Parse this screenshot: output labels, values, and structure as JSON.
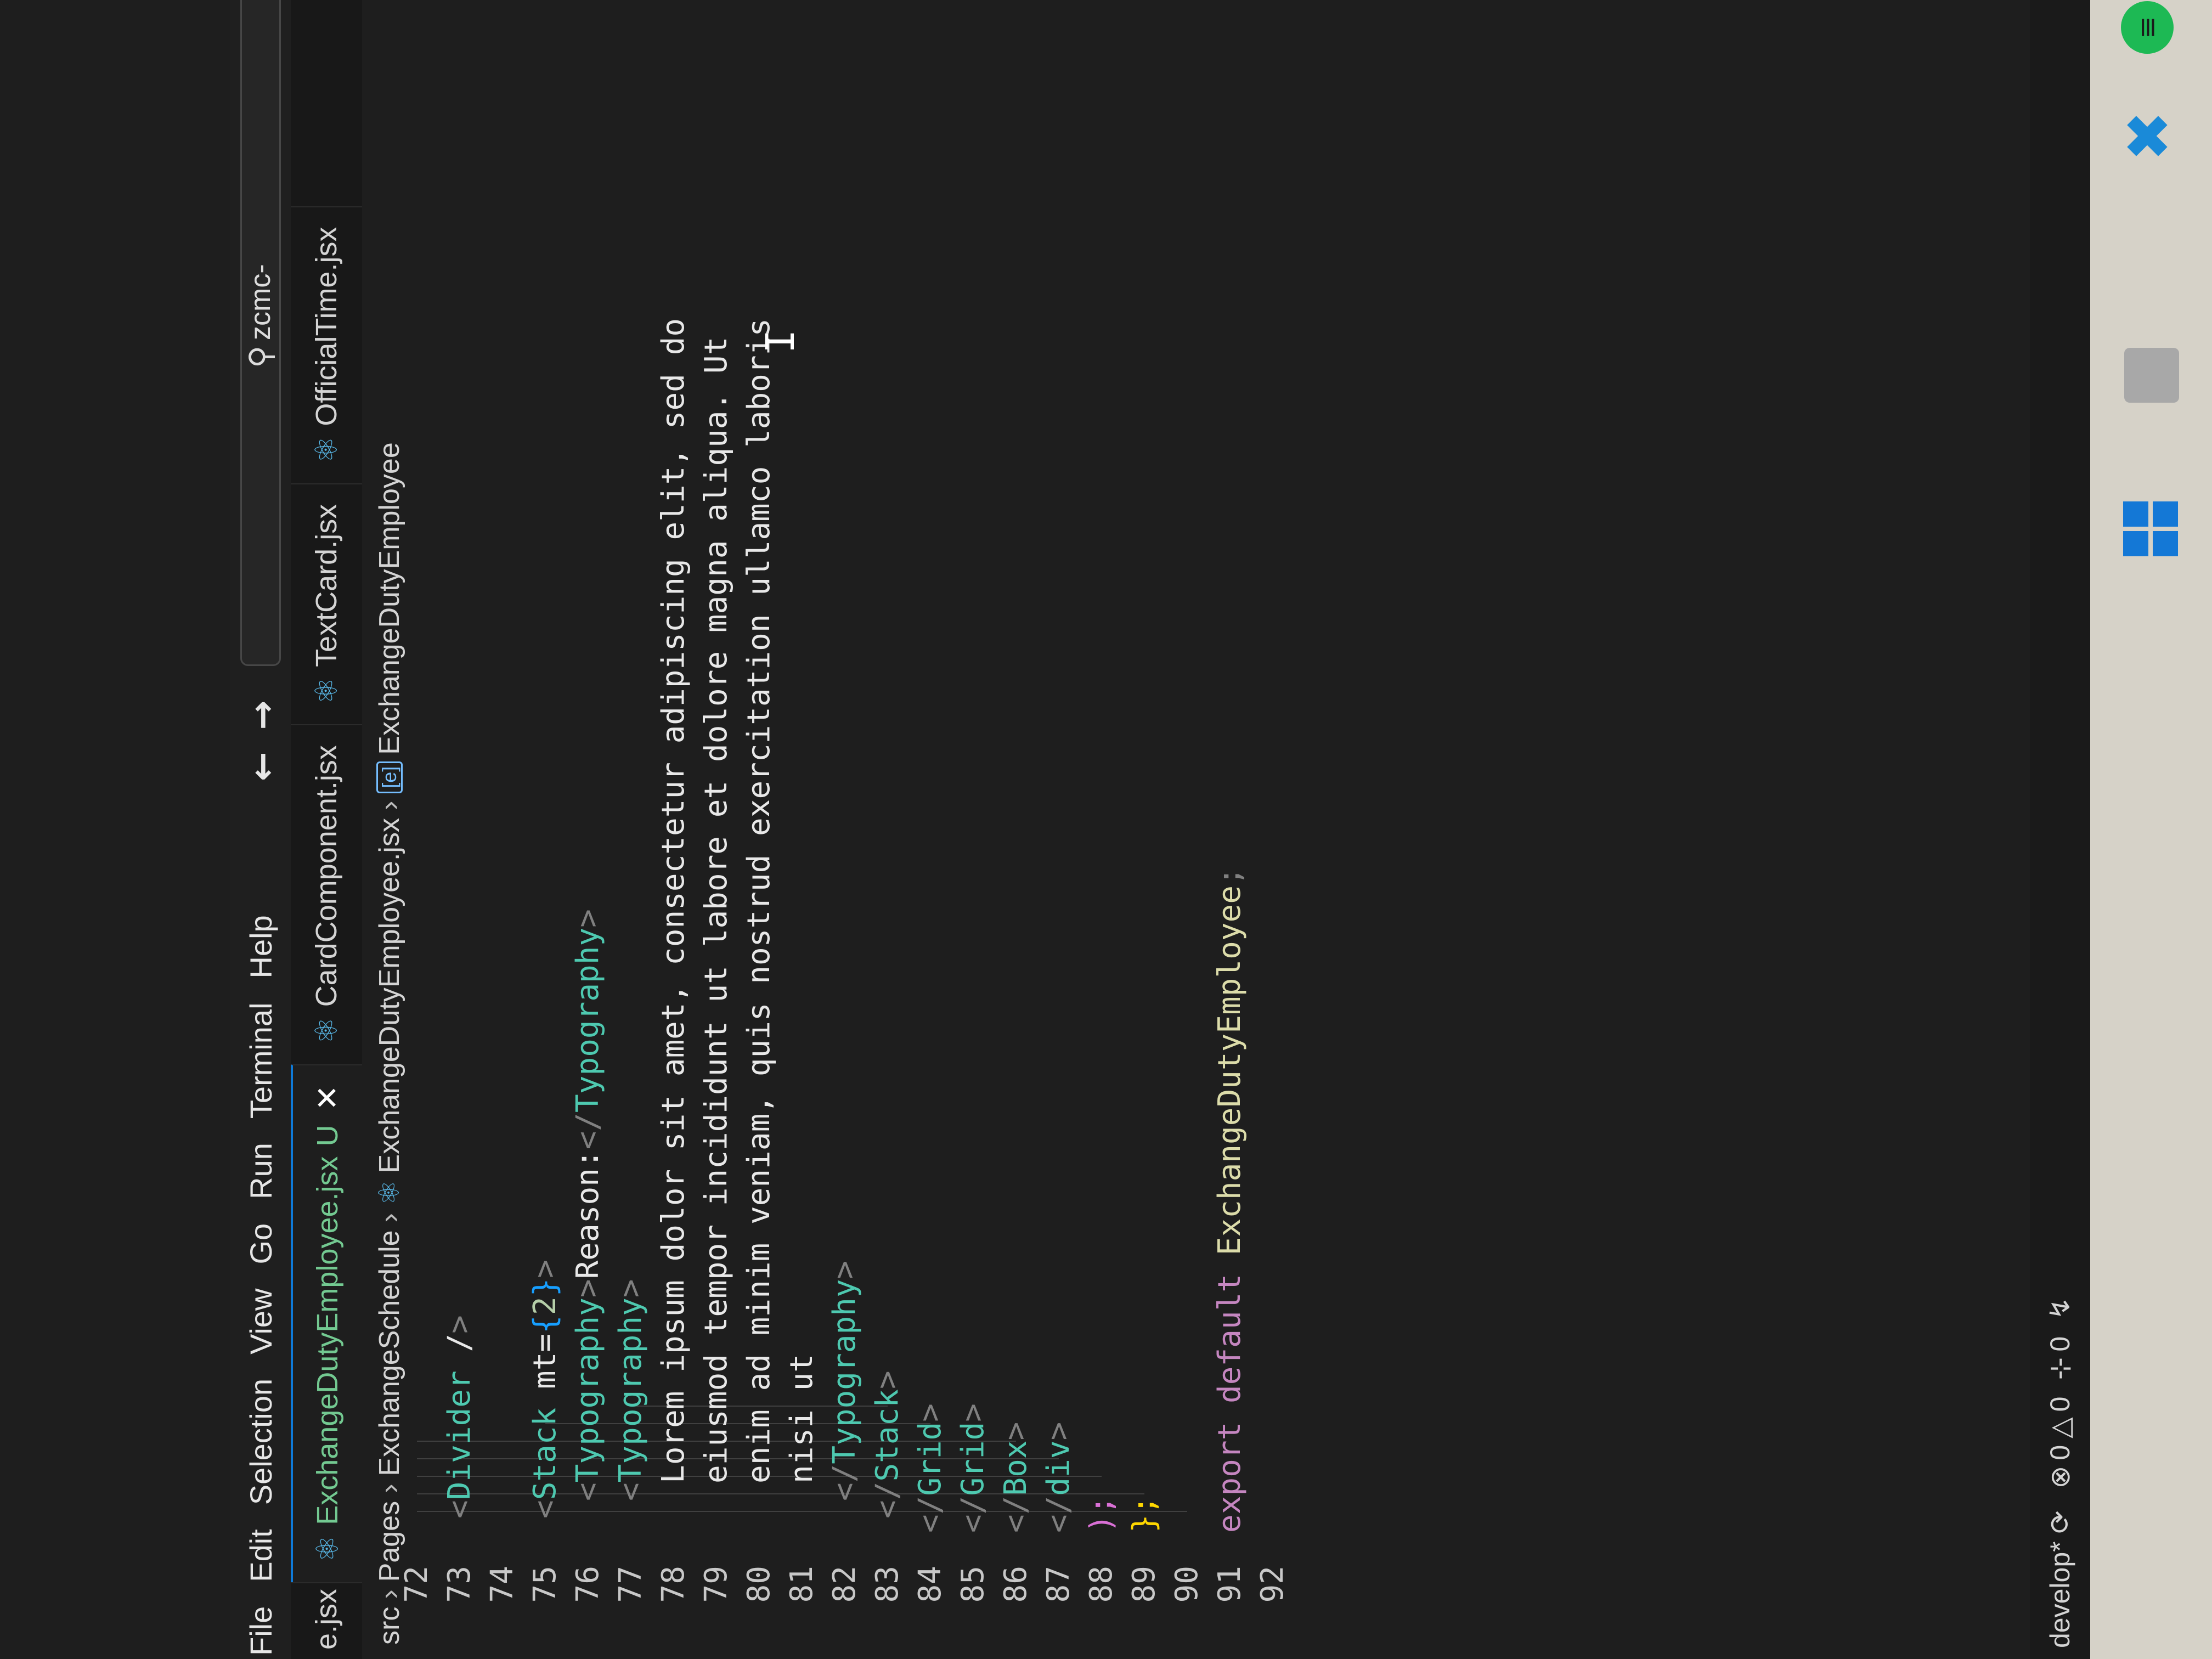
{
  "menu": {
    "items": [
      "File",
      "Edit",
      "Selection",
      "View",
      "Go",
      "Run",
      "Terminal",
      "Help"
    ],
    "search_text": "zcmc-"
  },
  "tabs": [
    {
      "label": "e.jsx",
      "partial": true
    },
    {
      "label": "ExchangeDutyEmployee.jsx",
      "modified": "U",
      "active": true
    },
    {
      "label": "CardComponent.jsx"
    },
    {
      "label": "TextCard.jsx"
    },
    {
      "label": "OfficialTime.jsx"
    }
  ],
  "breadcrumb": [
    "src",
    "Pages",
    "ExchangeSchedule",
    "ExchangeDutyEmployee.jsx",
    "ExchangeDutyEmployee"
  ],
  "editor": {
    "lines": [
      {
        "n": "72",
        "text": ""
      },
      {
        "n": "73",
        "text": "<Divider />"
      },
      {
        "n": "74",
        "text": ""
      },
      {
        "n": "75",
        "text": "<Stack mt={2}>"
      },
      {
        "n": "76",
        "text": "<Typography>Reason:</Typography>"
      },
      {
        "n": "77",
        "text": "<Typography>"
      },
      {
        "n": "78",
        "text": "Lorem ipsum dolor sit amet, consectetur adipiscing elit, sed do"
      },
      {
        "n": "79",
        "text": "eiusmod tempor incididunt ut labore et dolore magna aliqua. Ut"
      },
      {
        "n": "80",
        "text": "enim ad minim veniam, quis nostrud exercitation ullamco laboris"
      },
      {
        "n": "81",
        "text": "nisi ut"
      },
      {
        "n": "82",
        "text": "</Typography>"
      },
      {
        "n": "83",
        "text": "</Stack>"
      },
      {
        "n": "84",
        "text": "</Grid>"
      },
      {
        "n": "85",
        "text": "</Grid>"
      },
      {
        "n": "86",
        "text": "</Box>"
      },
      {
        "n": "87",
        "text": "</div>"
      },
      {
        "n": "88",
        "text": ");"
      },
      {
        "n": "89",
        "text": "};"
      },
      {
        "n": "90",
        "text": ""
      },
      {
        "n": "91",
        "text": "export default ExchangeDutyEmployee;"
      },
      {
        "n": "92",
        "text": ""
      }
    ]
  },
  "statusbar": {
    "branch": "develop*",
    "errors": "0",
    "warnings": "0",
    "ports": "0"
  },
  "colors": {
    "editor_bg": "#1e1e1e",
    "tag": "#4ec9b0",
    "attribute": "#9cdcfe",
    "keyword": "#c586c0",
    "identifier": "#dcdcaa",
    "active_tab_accent": "#0e7ad8",
    "modified": "#73c991"
  }
}
